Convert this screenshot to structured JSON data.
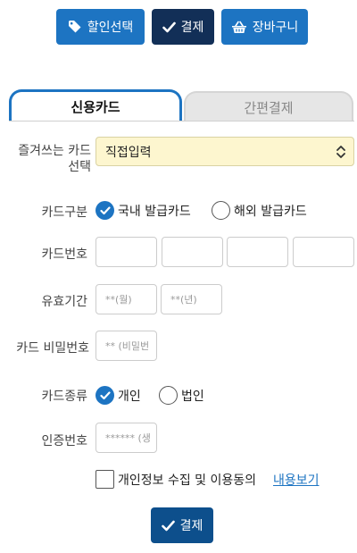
{
  "top_buttons": {
    "discount": "할인선택",
    "pay": "결제",
    "cart": "장바구니"
  },
  "tabs": [
    {
      "label": "신용카드",
      "active": true
    },
    {
      "label": "간편결제",
      "active": false
    }
  ],
  "form": {
    "favorite_card_label": "즐겨쓰는 카드 선택",
    "favorite_card_value": "직접입력",
    "card_type_label": "카드구분",
    "card_type_options": [
      "국내 발급카드",
      "해외 발급카드"
    ],
    "card_number_label": "카드번호",
    "expiry_label": "유효기간",
    "expiry_month_placeholder": "**(월)",
    "expiry_year_placeholder": "**(년)",
    "password_label": "카드 비밀번호",
    "password_placeholder": "** (비밀번",
    "card_kind_label": "카드종류",
    "card_kind_options": [
      "개인",
      "법인"
    ],
    "auth_label": "인증번호",
    "auth_placeholder": "****** (생",
    "agree_text": "개인정보 수집 및 이용동의",
    "agree_link": "내용보기",
    "submit_label": "결제"
  },
  "colors": {
    "primary": "#1d74c2",
    "navy": "#122f57",
    "select_bg": "#fdf6cf"
  }
}
